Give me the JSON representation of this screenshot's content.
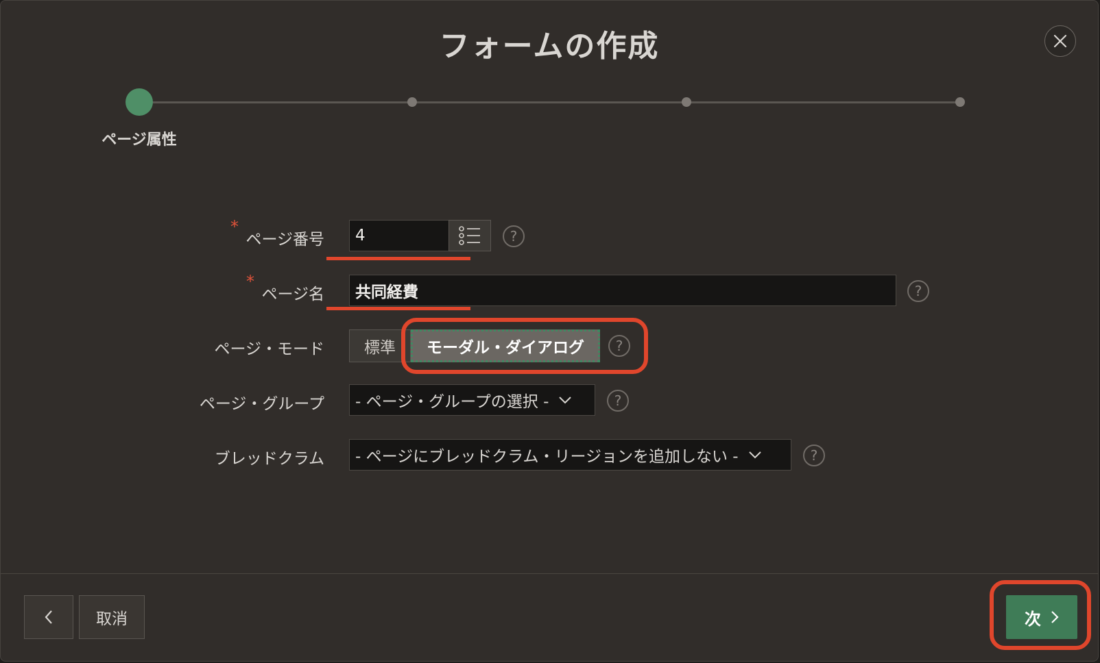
{
  "dialog": {
    "title": "フォームの作成"
  },
  "wizard": {
    "active_step_label": "ページ属性",
    "step_count": 4,
    "current_step": 1
  },
  "form": {
    "page_number": {
      "label": "ページ番号",
      "value": "4",
      "required": true
    },
    "page_name": {
      "label": "ページ名",
      "value": "共同経費",
      "required": true
    },
    "page_mode": {
      "label": "ページ・モード",
      "options": [
        "標準",
        "モーダル・ダイアログ"
      ],
      "option_standard": "標準",
      "option_modal": "モーダル・ダイアログ",
      "selected": "モーダル・ダイアログ"
    },
    "page_group": {
      "label": "ページ・グループ",
      "value": "- ページ・グループの選択 -"
    },
    "breadcrumb": {
      "label": "ブレッドクラム",
      "value": "- ページにブレッドクラム・リージョンを追加しない -"
    },
    "help_glyph": "?"
  },
  "footer": {
    "back_icon": "chevron-left-icon",
    "cancel_label": "取消",
    "next_label": "次"
  },
  "colors": {
    "accent_green": "#4f8f67",
    "annotation_red": "#e0462c",
    "required_red": "#e0533a"
  }
}
